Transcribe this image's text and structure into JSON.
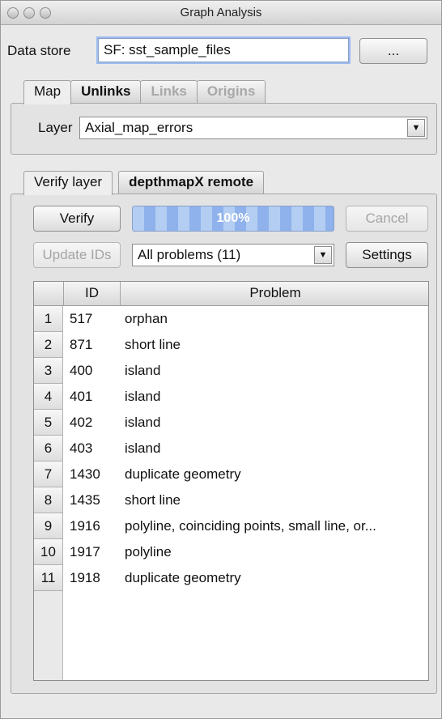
{
  "window": {
    "title": "Graph Analysis"
  },
  "datastore": {
    "label": "Data store",
    "value": "SF: sst_sample_files",
    "browse_label": "..."
  },
  "top_tabs": [
    {
      "label": "Map",
      "state": "active"
    },
    {
      "label": "Unlinks",
      "state": "normal"
    },
    {
      "label": "Links",
      "state": "disabled"
    },
    {
      "label": "Origins",
      "state": "disabled"
    }
  ],
  "layer": {
    "label": "Layer",
    "value": "Axial_map_errors"
  },
  "bottom_tabs": [
    {
      "label": "Verify layer",
      "state": "active"
    },
    {
      "label": "depthmapX remote",
      "state": "normal"
    }
  ],
  "verify": {
    "verify_label": "Verify",
    "progress_text": "100%",
    "progress": 1.0,
    "cancel_label": "Cancel",
    "update_ids_label": "Update IDs",
    "filter_value": "All problems (11)",
    "settings_label": "Settings"
  },
  "table": {
    "columns": [
      "ID",
      "Problem"
    ],
    "rows": [
      {
        "n": "1",
        "id": "517",
        "problem": "orphan"
      },
      {
        "n": "2",
        "id": "871",
        "problem": "short line"
      },
      {
        "n": "3",
        "id": "400",
        "problem": "island"
      },
      {
        "n": "4",
        "id": "401",
        "problem": "island"
      },
      {
        "n": "5",
        "id": "402",
        "problem": "island"
      },
      {
        "n": "6",
        "id": "403",
        "problem": "island"
      },
      {
        "n": "7",
        "id": "1430",
        "problem": "duplicate geometry"
      },
      {
        "n": "8",
        "id": "1435",
        "problem": "short line"
      },
      {
        "n": "9",
        "id": "1916",
        "problem": "polyline, coinciding points, small line, or..."
      },
      {
        "n": "10",
        "id": "1917",
        "problem": "polyline"
      },
      {
        "n": "11",
        "id": "1918",
        "problem": "duplicate geometry"
      }
    ]
  }
}
